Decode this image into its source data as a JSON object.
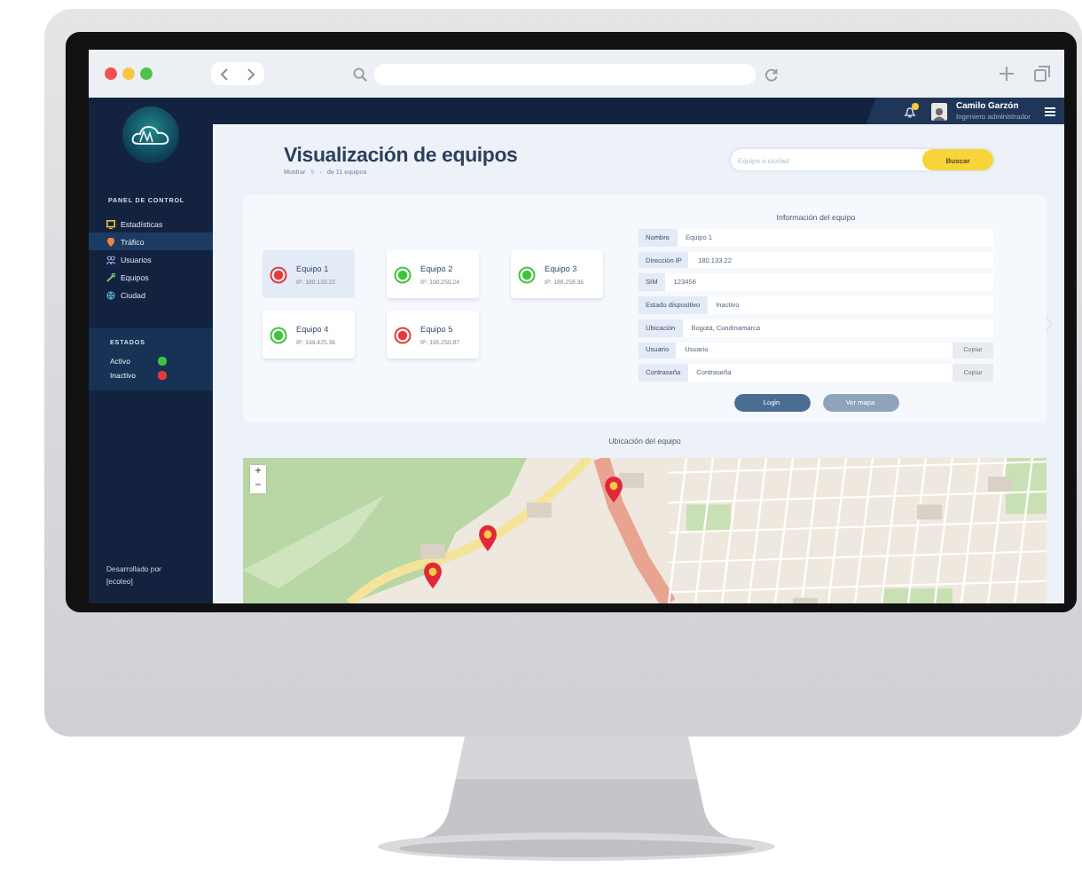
{
  "header": {
    "has_notification": true,
    "user_name": "Camilo Garzón",
    "user_role": "Ingeniero administrador"
  },
  "sidebar": {
    "section_title": "PANEL DE CONTROL",
    "items": [
      {
        "label": "Estadísticas",
        "selected": false
      },
      {
        "label": "Tráfico",
        "selected": true
      },
      {
        "label": "Usuarios",
        "selected": false
      },
      {
        "label": "Equipos",
        "selected": false
      },
      {
        "label": "Ciudad",
        "selected": false
      }
    ],
    "status_title": "ESTADOS",
    "statuses": [
      {
        "label": "Activo",
        "color": "#3ec43b"
      },
      {
        "label": "Inactivo",
        "color": "#e5393a"
      }
    ],
    "footer_lines": [
      "Desarrollado por",
      "[ecoteo]"
    ]
  },
  "main": {
    "title": "Visualización de equipos",
    "pager": {
      "prefix": "Mostrar",
      "count": "5",
      "separator": "-",
      "suffix": "de 11 equipos"
    },
    "search": {
      "placeholder": "Equipo o ciudad",
      "button": "Buscar"
    },
    "devices": [
      {
        "name": "Equipo 1",
        "ip": "IP: 180.133.22",
        "active": false,
        "selected": true
      },
      {
        "name": "Equipo 2",
        "ip": "IP: 190.250.24",
        "active": true,
        "selected": false
      },
      {
        "name": "Equipo 3",
        "ip": "IP: 188.258.36",
        "active": true,
        "selected": false
      },
      {
        "name": "Equipo 4",
        "ip": "IP: 199.425.36",
        "active": true,
        "selected": false
      },
      {
        "name": "Equipo 5",
        "ip": "IP: 195.250.87",
        "active": false,
        "selected": false
      }
    ],
    "info": {
      "title": "Información del equipo",
      "fields": [
        {
          "label": "Nombre",
          "value": "Equipo 1"
        },
        {
          "label": "Dirección IP",
          "value": "180.133.22"
        },
        {
          "label": "SIM",
          "value": "123456"
        },
        {
          "label": "Estado dispositivo",
          "value": "Inactivo"
        },
        {
          "label": "Ubicación",
          "value": "Bogotá, Cundinamarca"
        },
        {
          "label": "Usuario",
          "value": "Usuario",
          "action": "Copiar"
        },
        {
          "label": "Contraseña",
          "value": "Contraseña",
          "action": "Copiar"
        }
      ],
      "buttons": [
        {
          "label": "Login",
          "kind": "primary"
        },
        {
          "label": "Ver mapa",
          "kind": "secondary"
        }
      ]
    },
    "map": {
      "title": "Ubicación del equipo",
      "zoom_in": "+",
      "zoom_out": "−"
    }
  }
}
